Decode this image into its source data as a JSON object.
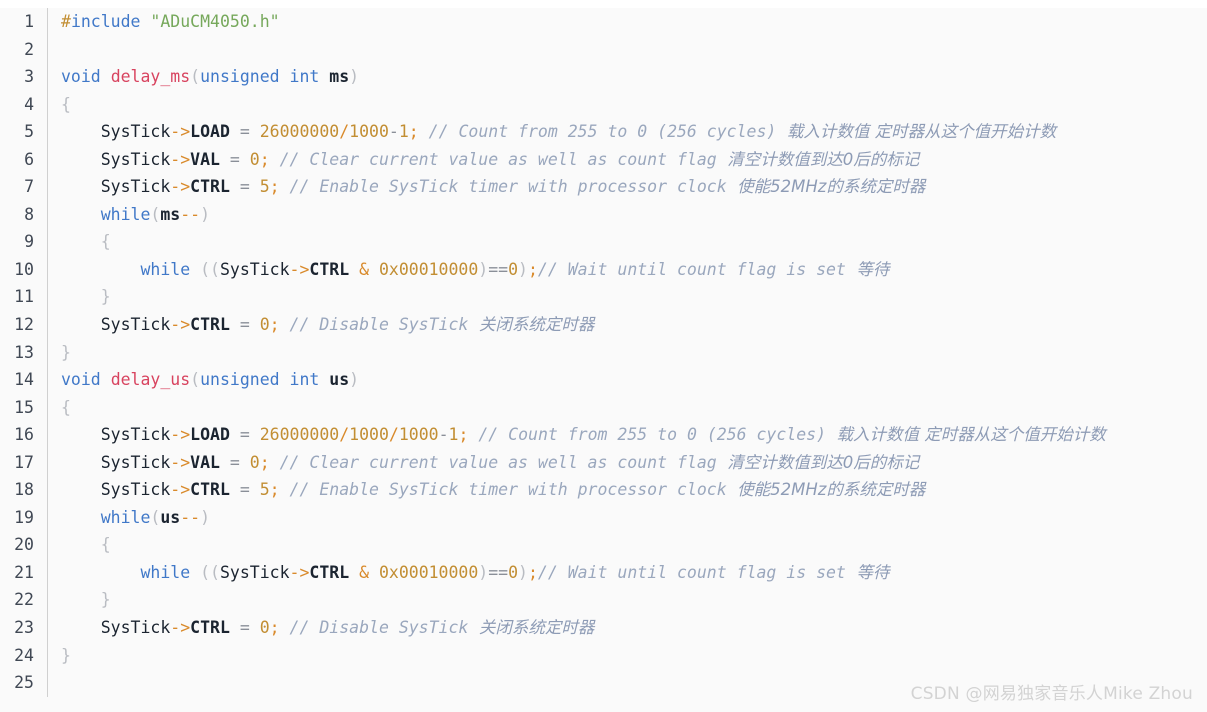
{
  "editor": {
    "language": "c",
    "background_color": "#fafafa",
    "gutter_separator_color": "#d0d0d0",
    "line_number_color": "#404854",
    "total_lines": 25,
    "line_numbers": [
      "1",
      "2",
      "3",
      "4",
      "5",
      "6",
      "7",
      "8",
      "9",
      "10",
      "11",
      "12",
      "13",
      "14",
      "15",
      "16",
      "17",
      "18",
      "19",
      "20",
      "21",
      "22",
      "23",
      "24",
      "25"
    ],
    "colors": {
      "preprocessor": "#c28e33",
      "keyword": "#4078c8",
      "string": "#76a85b",
      "function": "#d8435f",
      "identifier_bold": "#1b2430",
      "number": "#c28e33",
      "operator": "#8a8f98",
      "punctuation": "#b9bcc2",
      "arrow": "#d98a2b",
      "comment": "#9aa7bd",
      "comment_cjk": "#8d9bb5"
    },
    "lines": [
      {
        "n": "1",
        "text": "#include \"ADuCM4050.h\""
      },
      {
        "n": "2",
        "text": ""
      },
      {
        "n": "3",
        "text": "void delay_ms(unsigned int ms)"
      },
      {
        "n": "4",
        "text": "{"
      },
      {
        "n": "5",
        "text": "    SysTick->LOAD = 26000000/1000-1; // Count from 255 to 0 (256 cycles)  载入计数值 定时器从这个值开始计数"
      },
      {
        "n": "6",
        "text": "    SysTick->VAL = 0; // Clear current value as well as count flag  清空计数值到达0后的标记"
      },
      {
        "n": "7",
        "text": "    SysTick->CTRL = 5; // Enable SysTick timer with processor clock  使能52MHz的系统定时器"
      },
      {
        "n": "8",
        "text": "    while(ms--)"
      },
      {
        "n": "9",
        "text": "    {"
      },
      {
        "n": "10",
        "text": "        while ((SysTick->CTRL & 0x00010000)==0);// Wait until count flag is set  等待"
      },
      {
        "n": "11",
        "text": "    }"
      },
      {
        "n": "12",
        "text": "    SysTick->CTRL = 0; // Disable SysTick  关闭系统定时器"
      },
      {
        "n": "13",
        "text": "}"
      },
      {
        "n": "14",
        "text": "void delay_us(unsigned int us)"
      },
      {
        "n": "15",
        "text": "{"
      },
      {
        "n": "16",
        "text": "    SysTick->LOAD = 26000000/1000/1000-1; // Count from 255 to 0 (256 cycles)  载入计数值 定时器从这个值开始计数"
      },
      {
        "n": "17",
        "text": "    SysTick->VAL = 0; // Clear current value as well as count flag  清空计数值到达0后的标记"
      },
      {
        "n": "18",
        "text": "    SysTick->CTRL = 5; // Enable SysTick timer with processor clock  使能52MHz的系统定时器"
      },
      {
        "n": "19",
        "text": "    while(us--)"
      },
      {
        "n": "20",
        "text": "    {"
      },
      {
        "n": "21",
        "text": "        while ((SysTick->CTRL & 0x00010000)==0);// Wait until count flag is set  等待"
      },
      {
        "n": "22",
        "text": "    }"
      },
      {
        "n": "23",
        "text": "    SysTick->CTRL = 0; // Disable SysTick  关闭系统定时器"
      },
      {
        "n": "24",
        "text": "}"
      },
      {
        "n": "25",
        "text": ""
      }
    ],
    "tokens": {
      "l1": [
        [
          "t-pre",
          "#"
        ],
        [
          "t-kw",
          "include"
        ],
        [
          "plain",
          " "
        ],
        [
          "t-str",
          "\"ADuCM4050.h\""
        ]
      ],
      "l2": [],
      "l3": [
        [
          "t-kw",
          "void"
        ],
        [
          "plain",
          " "
        ],
        [
          "t-fn",
          "delay_ms"
        ],
        [
          "t-punc",
          "("
        ],
        [
          "t-kw",
          "unsigned int"
        ],
        [
          "plain",
          " "
        ],
        [
          "t-var",
          "ms"
        ],
        [
          "t-punc",
          ")"
        ]
      ],
      "l4": [
        [
          "t-punc",
          "{"
        ]
      ],
      "l5": [
        [
          "plain",
          "    "
        ],
        [
          "t-obj",
          "SysTick"
        ],
        [
          "t-arrow",
          "->"
        ],
        [
          "t-var",
          "LOAD"
        ],
        [
          "plain",
          " "
        ],
        [
          "t-op",
          "="
        ],
        [
          "plain",
          " "
        ],
        [
          "t-num",
          "26000000"
        ],
        [
          "t-arrow",
          "/"
        ],
        [
          "t-num",
          "1000"
        ],
        [
          "t-op",
          "-"
        ],
        [
          "t-num",
          "1"
        ],
        [
          "t-arrow",
          ";"
        ],
        [
          "plain",
          " "
        ],
        [
          "t-cm",
          "// Count from 255 to 0 (256 cycles)"
        ],
        [
          "t-cn",
          "  载入计数值 定时器从这个值开始计数"
        ]
      ],
      "l6": [
        [
          "plain",
          "    "
        ],
        [
          "t-obj",
          "SysTick"
        ],
        [
          "t-arrow",
          "->"
        ],
        [
          "t-var",
          "VAL"
        ],
        [
          "plain",
          " "
        ],
        [
          "t-op",
          "="
        ],
        [
          "plain",
          " "
        ],
        [
          "t-num",
          "0"
        ],
        [
          "t-arrow",
          ";"
        ],
        [
          "plain",
          " "
        ],
        [
          "t-cm",
          "// Clear current value as well as count flag"
        ],
        [
          "t-cn",
          "  清空计数值到达0后的标记"
        ]
      ],
      "l7": [
        [
          "plain",
          "    "
        ],
        [
          "t-obj",
          "SysTick"
        ],
        [
          "t-arrow",
          "->"
        ],
        [
          "t-var",
          "CTRL"
        ],
        [
          "plain",
          " "
        ],
        [
          "t-op",
          "="
        ],
        [
          "plain",
          " "
        ],
        [
          "t-num",
          "5"
        ],
        [
          "t-arrow",
          ";"
        ],
        [
          "plain",
          " "
        ],
        [
          "t-cm",
          "// Enable SysTick timer with processor clock"
        ],
        [
          "t-cn",
          "  使能52MHz的系统定时器"
        ]
      ],
      "l8": [
        [
          "plain",
          "    "
        ],
        [
          "t-kw",
          "while"
        ],
        [
          "t-punc",
          "("
        ],
        [
          "t-var",
          "ms"
        ],
        [
          "t-arrow",
          "--"
        ],
        [
          "t-punc",
          ")"
        ]
      ],
      "l9": [
        [
          "plain",
          "    "
        ],
        [
          "t-punc",
          "{"
        ]
      ],
      "l10": [
        [
          "plain",
          "        "
        ],
        [
          "t-kw",
          "while"
        ],
        [
          "plain",
          " "
        ],
        [
          "t-punc",
          "(("
        ],
        [
          "t-obj",
          "SysTick"
        ],
        [
          "t-arrow",
          "->"
        ],
        [
          "t-var",
          "CTRL"
        ],
        [
          "plain",
          " "
        ],
        [
          "t-arrow",
          "&"
        ],
        [
          "plain",
          " "
        ],
        [
          "t-num",
          "0x00010000"
        ],
        [
          "t-punc",
          ")"
        ],
        [
          "t-op",
          "=="
        ],
        [
          "t-num",
          "0"
        ],
        [
          "t-punc",
          ")"
        ],
        [
          "t-arrow",
          ";"
        ],
        [
          "t-cm",
          "// Wait until count flag is set"
        ],
        [
          "t-cn",
          "  等待"
        ]
      ],
      "l11": [
        [
          "plain",
          "    "
        ],
        [
          "t-punc",
          "}"
        ]
      ],
      "l12": [
        [
          "plain",
          "    "
        ],
        [
          "t-obj",
          "SysTick"
        ],
        [
          "t-arrow",
          "->"
        ],
        [
          "t-var",
          "CTRL"
        ],
        [
          "plain",
          " "
        ],
        [
          "t-op",
          "="
        ],
        [
          "plain",
          " "
        ],
        [
          "t-num",
          "0"
        ],
        [
          "t-arrow",
          ";"
        ],
        [
          "plain",
          " "
        ],
        [
          "t-cm",
          "// Disable SysTick"
        ],
        [
          "t-cn",
          "  关闭系统定时器"
        ]
      ],
      "l13": [
        [
          "t-punc",
          "}"
        ]
      ],
      "l14": [
        [
          "t-kw",
          "void"
        ],
        [
          "plain",
          " "
        ],
        [
          "t-fn",
          "delay_us"
        ],
        [
          "t-punc",
          "("
        ],
        [
          "t-kw",
          "unsigned int"
        ],
        [
          "plain",
          " "
        ],
        [
          "t-var",
          "us"
        ],
        [
          "t-punc",
          ")"
        ]
      ],
      "l15": [
        [
          "t-punc",
          "{"
        ]
      ],
      "l16": [
        [
          "plain",
          "    "
        ],
        [
          "t-obj",
          "SysTick"
        ],
        [
          "t-arrow",
          "->"
        ],
        [
          "t-var",
          "LOAD"
        ],
        [
          "plain",
          " "
        ],
        [
          "t-op",
          "="
        ],
        [
          "plain",
          " "
        ],
        [
          "t-num",
          "26000000"
        ],
        [
          "t-arrow",
          "/"
        ],
        [
          "t-num",
          "1000"
        ],
        [
          "t-arrow",
          "/"
        ],
        [
          "t-num",
          "1000"
        ],
        [
          "t-op",
          "-"
        ],
        [
          "t-num",
          "1"
        ],
        [
          "t-arrow",
          ";"
        ],
        [
          "plain",
          " "
        ],
        [
          "t-cm",
          "// Count from 255 to 0 (256 cycles)"
        ],
        [
          "t-cn",
          "  载入计数值 定时器从这个值开始计数"
        ]
      ],
      "l17": [
        [
          "plain",
          "    "
        ],
        [
          "t-obj",
          "SysTick"
        ],
        [
          "t-arrow",
          "->"
        ],
        [
          "t-var",
          "VAL"
        ],
        [
          "plain",
          " "
        ],
        [
          "t-op",
          "="
        ],
        [
          "plain",
          " "
        ],
        [
          "t-num",
          "0"
        ],
        [
          "t-arrow",
          ";"
        ],
        [
          "plain",
          " "
        ],
        [
          "t-cm",
          "// Clear current value as well as count flag"
        ],
        [
          "t-cn",
          "  清空计数值到达0后的标记"
        ]
      ],
      "l18": [
        [
          "plain",
          "    "
        ],
        [
          "t-obj",
          "SysTick"
        ],
        [
          "t-arrow",
          "->"
        ],
        [
          "t-var",
          "CTRL"
        ],
        [
          "plain",
          " "
        ],
        [
          "t-op",
          "="
        ],
        [
          "plain",
          " "
        ],
        [
          "t-num",
          "5"
        ],
        [
          "t-arrow",
          ";"
        ],
        [
          "plain",
          " "
        ],
        [
          "t-cm",
          "// Enable SysTick timer with processor clock"
        ],
        [
          "t-cn",
          "  使能52MHz的系统定时器"
        ]
      ],
      "l19": [
        [
          "plain",
          "    "
        ],
        [
          "t-kw",
          "while"
        ],
        [
          "t-punc",
          "("
        ],
        [
          "t-var",
          "us"
        ],
        [
          "t-arrow",
          "--"
        ],
        [
          "t-punc",
          ")"
        ]
      ],
      "l20": [
        [
          "plain",
          "    "
        ],
        [
          "t-punc",
          "{"
        ]
      ],
      "l21": [
        [
          "plain",
          "        "
        ],
        [
          "t-kw",
          "while"
        ],
        [
          "plain",
          " "
        ],
        [
          "t-punc",
          "(("
        ],
        [
          "t-obj",
          "SysTick"
        ],
        [
          "t-arrow",
          "->"
        ],
        [
          "t-var",
          "CTRL"
        ],
        [
          "plain",
          " "
        ],
        [
          "t-arrow",
          "&"
        ],
        [
          "plain",
          " "
        ],
        [
          "t-num",
          "0x00010000"
        ],
        [
          "t-punc",
          ")"
        ],
        [
          "t-op",
          "=="
        ],
        [
          "t-num",
          "0"
        ],
        [
          "t-punc",
          ")"
        ],
        [
          "t-arrow",
          ";"
        ],
        [
          "t-cm",
          "// Wait until count flag is set"
        ],
        [
          "t-cn",
          "  等待"
        ]
      ],
      "l22": [
        [
          "plain",
          "    "
        ],
        [
          "t-punc",
          "}"
        ]
      ],
      "l23": [
        [
          "plain",
          "    "
        ],
        [
          "t-obj",
          "SysTick"
        ],
        [
          "t-arrow",
          "->"
        ],
        [
          "t-var",
          "CTRL"
        ],
        [
          "plain",
          " "
        ],
        [
          "t-op",
          "="
        ],
        [
          "plain",
          " "
        ],
        [
          "t-num",
          "0"
        ],
        [
          "t-arrow",
          ";"
        ],
        [
          "plain",
          " "
        ],
        [
          "t-cm",
          "// Disable SysTick"
        ],
        [
          "t-cn",
          "  关闭系统定时器"
        ]
      ],
      "l24": [
        [
          "t-punc",
          "}"
        ]
      ],
      "l25": []
    }
  },
  "watermark": {
    "text": "CSDN @网易独家音乐人Mike Zhou"
  }
}
